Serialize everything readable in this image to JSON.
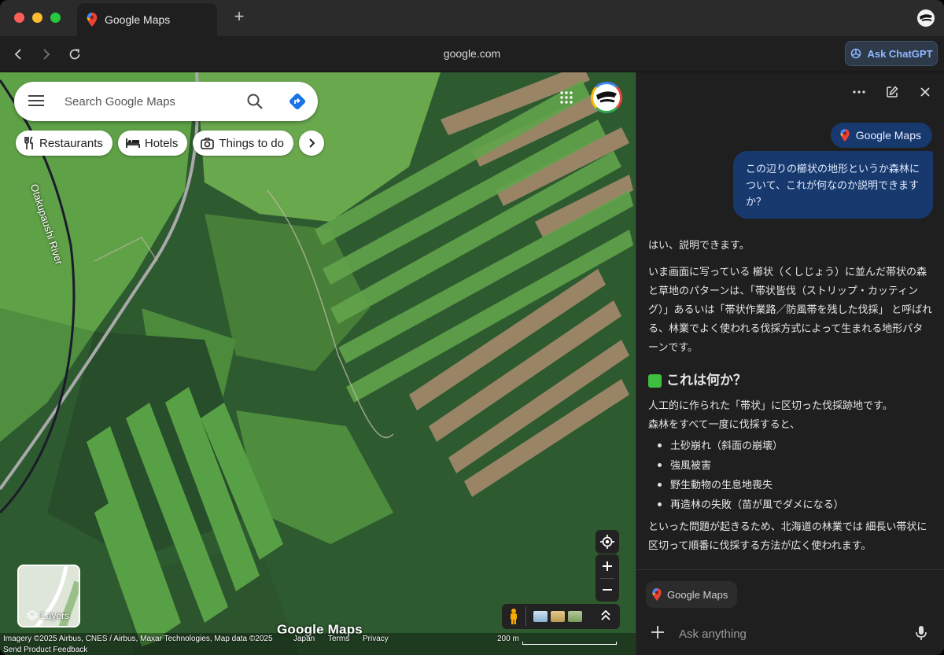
{
  "browser": {
    "tab_title": "Google Maps",
    "url": "google.com",
    "ask_button_label": "Ask ChatGPT"
  },
  "map": {
    "search_placeholder": "Search Google Maps",
    "chips": [
      {
        "label": "Restaurants",
        "icon": "fork-knife-icon"
      },
      {
        "label": "Hotels",
        "icon": "bed-icon"
      },
      {
        "label": "Things to do",
        "icon": "camera-icon"
      }
    ],
    "river_label": "Otakupaushi River",
    "layers_label": "Layers",
    "logo_text": "Google Maps",
    "attribution": {
      "imagery": "Imagery ©2025 Airbus, CNES / Airbus, Maxar Technologies, Map data ©2025",
      "country": "Japan",
      "terms": "Terms",
      "privacy": "Privacy",
      "scale": "200 m",
      "feedback": "Send Product Feedback"
    },
    "colors": {
      "forest": "#2f5d2f",
      "field": "#63a44a",
      "clearing": "#a2876a",
      "road": "#a9a9a9"
    }
  },
  "panel": {
    "context_pill": "Google Maps",
    "user_message": "この辺りの櫛状の地形というか森林について、これが何なのか説明できますか？",
    "reply": {
      "intro": "はい、説明できます。",
      "para1": "いま画面に写っている 櫛状（くしじょう）に並んだ帯状の森と草地のパターンは、「帯状皆伐（ストリップ・カッティング）」あるいは「帯状作業路／防風帯を残した伐採」 と呼ばれる、林業でよく使われる伐採方式によって生まれる地形パターンです。",
      "heading": "これは何か？",
      "para2a": "人工的に作られた「帯状」に区切った伐採跡地です。",
      "para2b": "森林をすべて一度に伐採すると、",
      "bullets": [
        "土砂崩れ（斜面の崩壊）",
        "強風被害",
        "野生動物の生息地喪失",
        "再造林の失敗（苗が風でダメになる）"
      ],
      "para3": "といった問題が起きるため、北海道の林業では 細長い帯状に区切って順番に伐採する方法が広く使われます。"
    },
    "context_chip": "Google Maps",
    "input_placeholder": "Ask anything"
  }
}
